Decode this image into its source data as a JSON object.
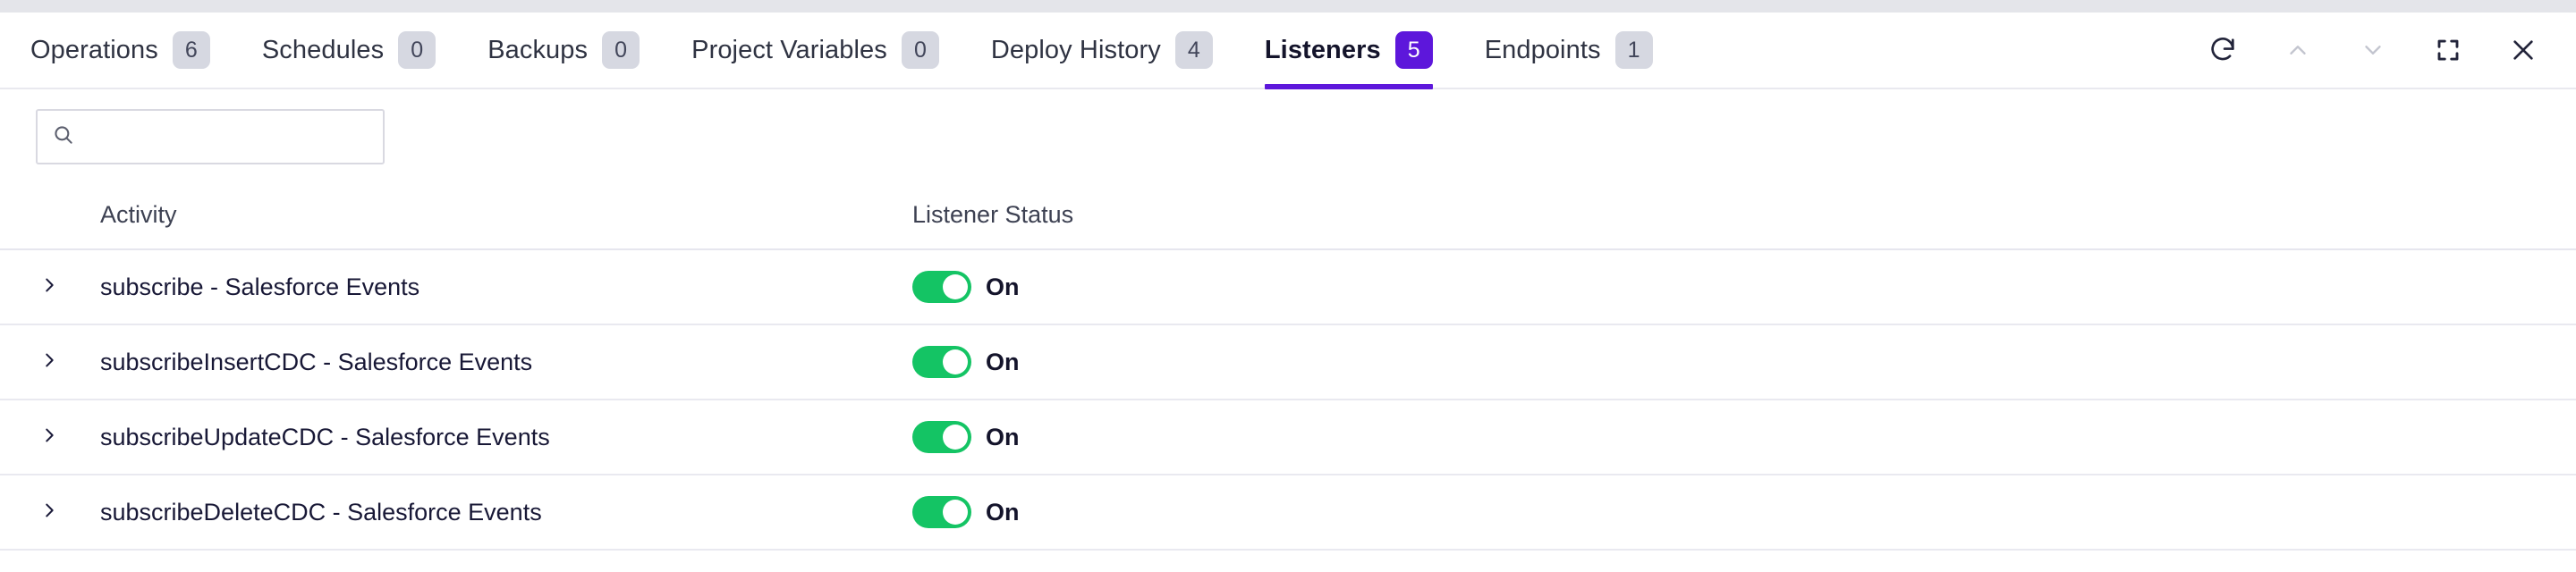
{
  "window": {
    "controls": [
      {
        "name": "refresh-button",
        "icon": "refresh-icon",
        "title": "Refresh",
        "state": "enabled"
      },
      {
        "name": "collapse-up-button",
        "icon": "chevron-up-icon",
        "title": "Previous",
        "state": "disabled"
      },
      {
        "name": "expand-down-button",
        "icon": "chevron-down-icon",
        "title": "Next",
        "state": "disabled"
      },
      {
        "name": "fullscreen-button",
        "icon": "fullscreen-icon",
        "title": "Fullscreen",
        "state": "enabled"
      },
      {
        "name": "close-button",
        "icon": "close-icon",
        "title": "Close",
        "state": "enabled"
      }
    ]
  },
  "tabs": [
    {
      "label": "Operations",
      "badge": "6",
      "active": false
    },
    {
      "label": "Schedules",
      "badge": "0",
      "active": false
    },
    {
      "label": "Backups",
      "badge": "0",
      "active": false
    },
    {
      "label": "Project Variables",
      "badge": "0",
      "active": false
    },
    {
      "label": "Deploy History",
      "badge": "4",
      "active": false
    },
    {
      "label": "Listeners",
      "badge": "5",
      "active": true
    },
    {
      "label": "Endpoints",
      "badge": "1",
      "active": false
    }
  ],
  "search": {
    "value": "",
    "placeholder": ""
  },
  "table": {
    "columns": [
      {
        "key": "activity",
        "label": "Activity"
      },
      {
        "key": "status",
        "label": "Listener Status"
      }
    ],
    "rows": [
      {
        "activity": "subscribe - Salesforce Events",
        "toggle_on": true,
        "status_label": "On"
      },
      {
        "activity": "subscribeInsertCDC - Salesforce Events",
        "toggle_on": true,
        "status_label": "On"
      },
      {
        "activity": "subscribeUpdateCDC - Salesforce Events",
        "toggle_on": true,
        "status_label": "On"
      },
      {
        "activity": "subscribeDeleteCDC - Salesforce Events",
        "toggle_on": true,
        "status_label": "On"
      }
    ]
  },
  "colors": {
    "accent_purple": "#5d17db",
    "toggle_green": "#14c464",
    "badge_gray": "#d6d8e1",
    "text_dark": "#14142b",
    "border_gray": "#e9e9f0",
    "top_strip": "#e4e5ea"
  }
}
